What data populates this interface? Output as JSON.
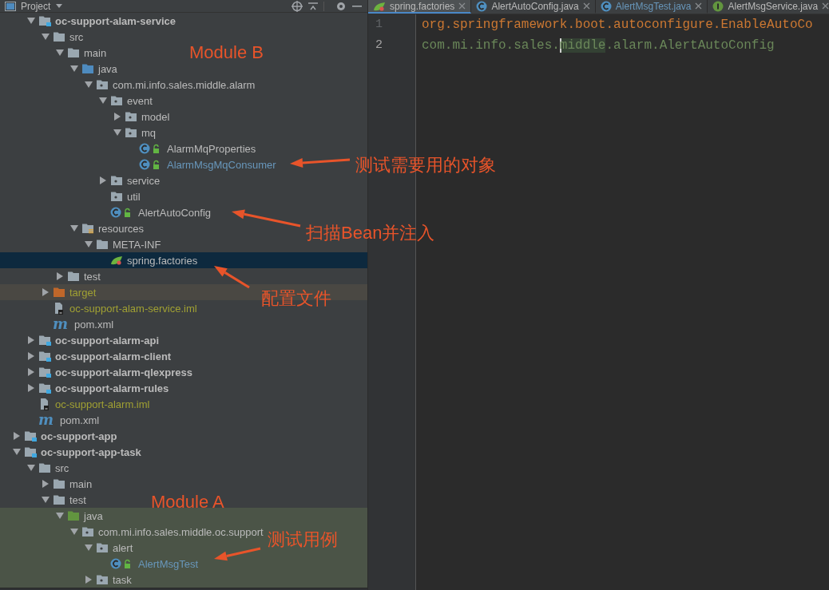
{
  "project_panel": {
    "title": "Project",
    "tree": {
      "scrolled_parent_children": [
        {
          "label": "oc-support-alam-service",
          "kind": "module",
          "expanded": true,
          "selected": false,
          "modified": false,
          "ignored": false,
          "children": [
            {
              "label": "src",
              "kind": "folder",
              "expanded": true,
              "selected": false,
              "modified": false,
              "ignored": false,
              "children": [
                {
                  "label": "main",
                  "kind": "folder",
                  "expanded": true,
                  "selected": false,
                  "modified": false,
                  "ignored": false,
                  "children": [
                    {
                      "label": "java",
                      "kind": "source-folder",
                      "expanded": true,
                      "selected": false,
                      "modified": false,
                      "ignored": false,
                      "children": [
                        {
                          "label": "com.mi.info.sales.middle.alarm",
                          "kind": "package",
                          "expanded": true,
                          "selected": false,
                          "modified": false,
                          "ignored": false,
                          "children": [
                            {
                              "label": "event",
                              "kind": "package",
                              "expanded": true,
                              "selected": false,
                              "modified": false,
                              "ignored": false,
                              "children": [
                                {
                                  "label": "model",
                                  "kind": "package",
                                  "expanded": false,
                                  "selected": false,
                                  "modified": false,
                                  "ignored": false
                                },
                                {
                                  "label": "mq",
                                  "kind": "package",
                                  "expanded": true,
                                  "selected": false,
                                  "modified": false,
                                  "ignored": false,
                                  "children": [
                                    {
                                      "label": "AlarmMqProperties",
                                      "kind": "class",
                                      "selected": false,
                                      "modified": false,
                                      "ignored": false
                                    },
                                    {
                                      "label": "AlarmMsgMqConsumer",
                                      "kind": "class",
                                      "selected": false,
                                      "modified": true,
                                      "ignored": false
                                    }
                                  ]
                                }
                              ]
                            },
                            {
                              "label": "service",
                              "kind": "package",
                              "expanded": false,
                              "selected": false,
                              "modified": false,
                              "ignored": false
                            },
                            {
                              "label": "util",
                              "kind": "package",
                              "selected": false,
                              "modified": false,
                              "ignored": false
                            },
                            {
                              "label": "AlertAutoConfig",
                              "kind": "class",
                              "selected": false,
                              "modified": false,
                              "ignored": false
                            }
                          ]
                        }
                      ]
                    },
                    {
                      "label": "resources",
                      "kind": "resources",
                      "expanded": true,
                      "selected": false,
                      "modified": false,
                      "ignored": false,
                      "children": [
                        {
                          "label": "META-INF",
                          "kind": "folder",
                          "expanded": true,
                          "selected": false,
                          "modified": false,
                          "ignored": false,
                          "children": [
                            {
                              "label": "spring.factories",
                              "kind": "spring",
                              "selected": true,
                              "modified": false,
                              "ignored": false
                            }
                          ]
                        }
                      ]
                    }
                  ]
                },
                {
                  "label": "test",
                  "kind": "folder",
                  "expanded": false,
                  "selected": false,
                  "modified": false,
                  "ignored": false
                }
              ]
            },
            {
              "label": "target",
              "kind": "excluded",
              "expanded": false,
              "selected": false,
              "modified": false,
              "ignored": true
            },
            {
              "label": "oc-support-alam-service.iml",
              "kind": "iml",
              "selected": false,
              "modified": false,
              "ignored": true
            },
            {
              "label": "pom.xml",
              "kind": "maven",
              "glyph": "m",
              "selected": false,
              "modified": false,
              "ignored": false
            }
          ]
        },
        {
          "label": "oc-support-alarm-api",
          "kind": "module",
          "expanded": false,
          "selected": false,
          "modified": false,
          "ignored": false
        },
        {
          "label": "oc-support-alarm-client",
          "kind": "module",
          "expanded": false,
          "selected": false,
          "modified": false,
          "ignored": false
        },
        {
          "label": "oc-support-alarm-qlexpress",
          "kind": "module",
          "expanded": false,
          "selected": false,
          "modified": false,
          "ignored": false
        },
        {
          "label": "oc-support-alarm-rules",
          "kind": "module",
          "expanded": false,
          "selected": false,
          "modified": false,
          "ignored": false
        },
        {
          "label": "oc-support-alarm.iml",
          "kind": "iml",
          "selected": false,
          "modified": false,
          "ignored": true
        },
        {
          "label": "pom.xml",
          "kind": "maven",
          "glyph": "m",
          "selected": false,
          "modified": false,
          "ignored": false
        }
      ],
      "items": [
        {
          "label": "oc-support-app",
          "kind": "module",
          "expanded": false,
          "selected": false,
          "modified": false,
          "ignored": false
        },
        {
          "label": "oc-support-app-task",
          "kind": "module",
          "expanded": true,
          "selected": false,
          "modified": false,
          "ignored": false,
          "children": [
            {
              "label": "src",
              "kind": "folder",
              "expanded": true,
              "selected": false,
              "modified": false,
              "ignored": false,
              "children": [
                {
                  "label": "main",
                  "kind": "folder",
                  "expanded": false,
                  "selected": false,
                  "modified": false,
                  "ignored": false
                },
                {
                  "label": "test",
                  "kind": "folder",
                  "expanded": true,
                  "selected": false,
                  "modified": false,
                  "ignored": false,
                  "children": [
                    {
                      "label": "java",
                      "kind": "test-source-folder",
                      "expanded": true,
                      "selected": false,
                      "modified": false,
                      "ignored": false,
                      "children": [
                        {
                          "label": "com.mi.info.sales.middle.oc.support",
                          "kind": "package",
                          "expanded": true,
                          "selected": false,
                          "modified": false,
                          "ignored": false,
                          "children": [
                            {
                              "label": "alert",
                              "kind": "package",
                              "expanded": true,
                              "selected": false,
                              "modified": false,
                              "ignored": false,
                              "children": [
                                {
                                  "label": "AlertMsgTest",
                                  "kind": "class",
                                  "selected": false,
                                  "modified": true,
                                  "ignored": false
                                }
                              ]
                            },
                            {
                              "label": "task",
                              "kind": "package",
                              "expanded": false,
                              "selected": false,
                              "modified": false,
                              "ignored": false
                            }
                          ]
                        }
                      ]
                    }
                  ]
                }
              ]
            }
          ]
        }
      ]
    }
  },
  "editor": {
    "tabs": [
      {
        "label": "spring.factories",
        "kind": "spring",
        "selected": true,
        "modified": false
      },
      {
        "label": "AlertAutoConfig.java",
        "kind": "class",
        "selected": false,
        "modified": false
      },
      {
        "label": "AlertMsgTest.java",
        "kind": "class",
        "selected": false,
        "modified": true
      },
      {
        "label": "AlertMsgService.java",
        "kind": "interface",
        "selected": false,
        "modified": false
      }
    ],
    "lines": [
      {
        "number": "1",
        "kind": "key",
        "current": false,
        "segments": [
          {
            "text": "org.springframework.boot.autoconfigure.EnableAutoCo",
            "highlighted": false,
            "caret": false
          }
        ]
      },
      {
        "number": "2",
        "kind": "value",
        "current": true,
        "segments": [
          {
            "text": "com.mi.info.sales.",
            "highlighted": false,
            "caret": false
          },
          {
            "text": "middle",
            "highlighted": true,
            "caret": true
          },
          {
            "text": ".alarm.AlertAutoConfig",
            "highlighted": false,
            "caret": false
          }
        ]
      }
    ]
  },
  "annotations": [
    {
      "text": "Module B",
      "arrow": false
    },
    {
      "text": "测试需要用的对象",
      "arrow": true
    },
    {
      "text": "扫描Bean并注入",
      "arrow": true
    },
    {
      "text": "配置文件",
      "arrow": true
    },
    {
      "text": "Module A",
      "arrow": false
    },
    {
      "text": "测试用例",
      "arrow": true
    }
  ]
}
